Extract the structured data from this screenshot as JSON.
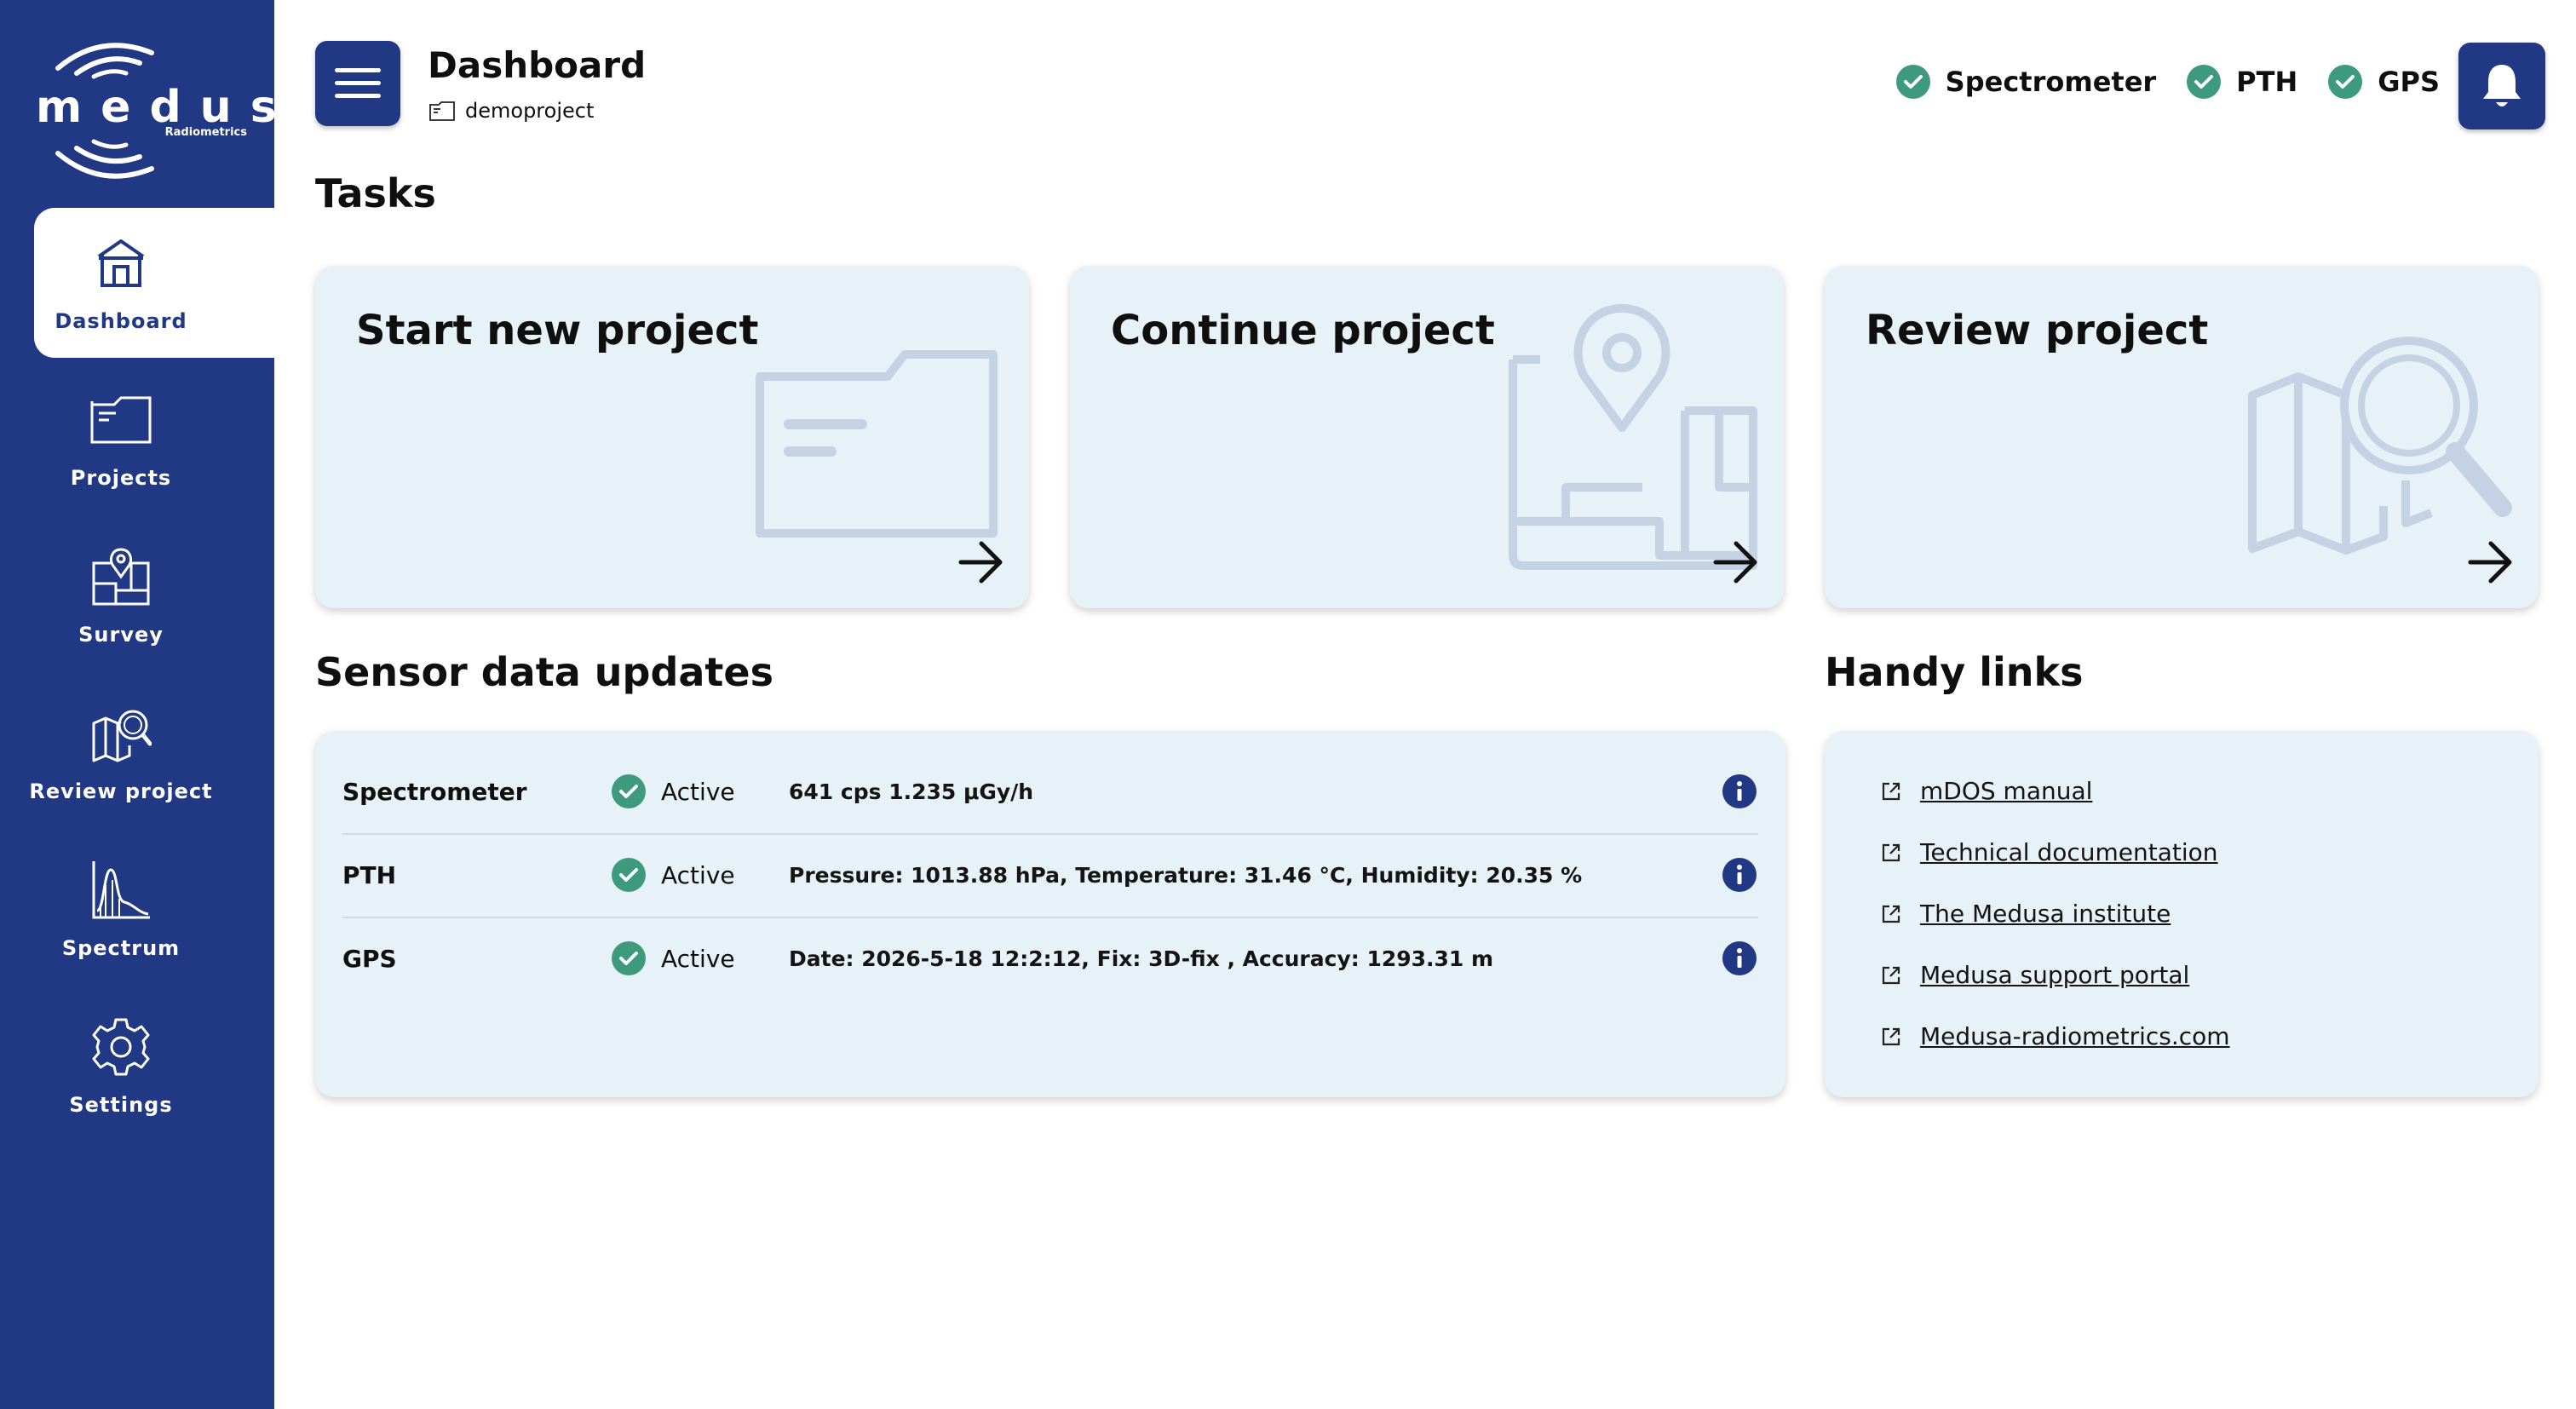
{
  "brand": {
    "name": "medusa",
    "sub": "Radiometrics"
  },
  "sidebar": {
    "items": [
      {
        "label": "Dashboard",
        "icon": "home-icon",
        "active": true
      },
      {
        "label": "Projects",
        "icon": "folder-icon"
      },
      {
        "label": "Survey",
        "icon": "survey-map-icon"
      },
      {
        "label": "Review project",
        "icon": "map-search-icon"
      },
      {
        "label": "Spectrum",
        "icon": "spectrum-chart-icon"
      },
      {
        "label": "Settings",
        "icon": "gear-icon"
      }
    ]
  },
  "header": {
    "title": "Dashboard",
    "project": "demoproject",
    "status": [
      {
        "label": "Spectrometer",
        "ok": true
      },
      {
        "label": "PTH",
        "ok": true
      },
      {
        "label": "GPS",
        "ok": true
      }
    ]
  },
  "tasks": {
    "heading": "Tasks",
    "cards": [
      {
        "title": "Start new project",
        "illustration": "folder-illustration"
      },
      {
        "title": "Continue project",
        "illustration": "map-pin-illustration"
      },
      {
        "title": "Review project",
        "illustration": "map-search-illustration"
      }
    ]
  },
  "sensors": {
    "heading": "Sensor data updates",
    "rows": [
      {
        "name": "Spectrometer",
        "state": "Active",
        "value": "641 cps 1.235 μGy/h"
      },
      {
        "name": "PTH",
        "state": "Active",
        "value": "Pressure: 1013.88 hPa, Temperature: 31.46 °C, Humidity: 20.35 %"
      },
      {
        "name": "GPS",
        "state": "Active",
        "value": "Date: 2026-5-18 12:2:12, Fix: 3D-fix , Accuracy: 1293.31 m"
      }
    ]
  },
  "links": {
    "heading": "Handy links",
    "items": [
      {
        "label": "mDOS manual"
      },
      {
        "label": "Technical documentation"
      },
      {
        "label": "The Medusa institute"
      },
      {
        "label": "Medusa support portal"
      },
      {
        "label": "Medusa-radiometrics.com"
      }
    ]
  },
  "colors": {
    "brand": "#213884",
    "card": "#e7f1f8",
    "ok": "#3d9a7c",
    "illustration": "#c5d2e4"
  }
}
